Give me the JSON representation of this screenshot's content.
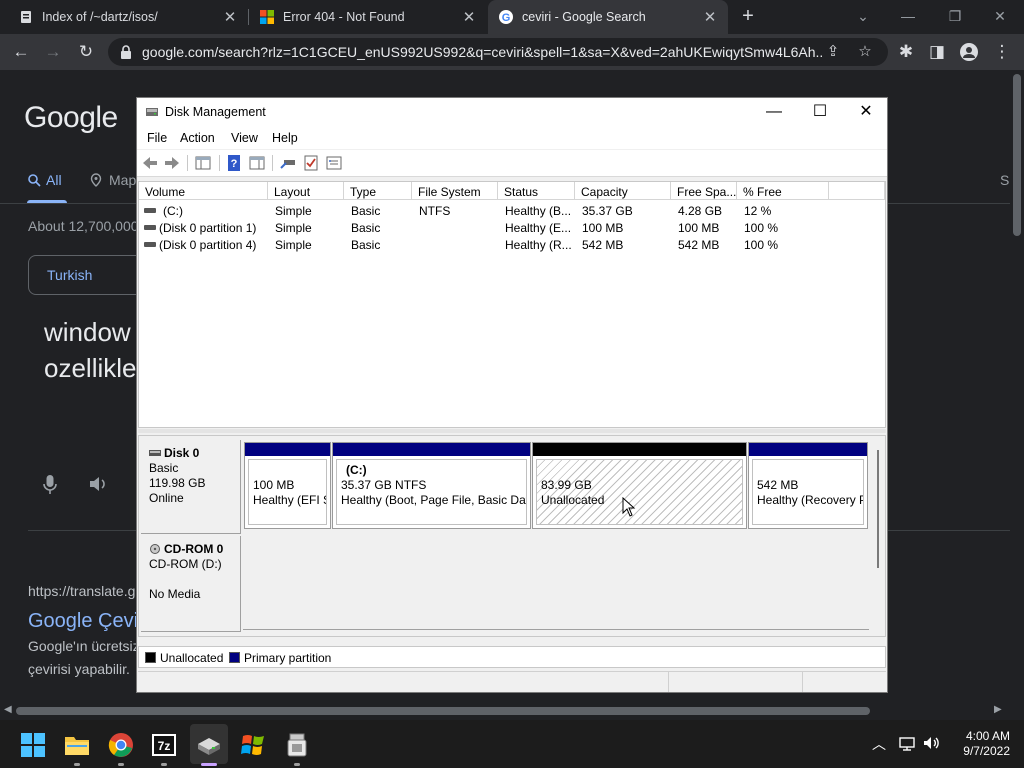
{
  "browser": {
    "tabs": [
      {
        "title": "Index of /~dartz/isos/",
        "icon": "file-server-icon"
      },
      {
        "title": "Error 404 - Not Found",
        "icon": "windows-logo-icon"
      },
      {
        "title": "ceviri - Google Search",
        "icon": "google-icon",
        "active": true
      }
    ],
    "url": "google.com/search?rlz=1C1GCEU_enUS992US992&q=ceviri&spell=1&sa=X&ved=2ahUKEwiqytSmw4L6Ah..."
  },
  "google": {
    "logo": "Google",
    "nav_all": "All",
    "nav_maps": "Map",
    "nav_right": "S",
    "stats": "About 12,700,000",
    "chip": "Turkish",
    "query_line1": "window",
    "query_line2": "ozellikle",
    "result_url": "https://translate.g",
    "result_title": "Google Çevi",
    "result_desc1": "Google'ın ücretsiz",
    "result_desc2": "çevirisi yapabilir."
  },
  "disk_management": {
    "title": "Disk Management",
    "menu": [
      "File",
      "Action",
      "View",
      "Help"
    ],
    "columns": [
      "Volume",
      "Layout",
      "Type",
      "File System",
      "Status",
      "Capacity",
      "Free Spa...",
      "% Free"
    ],
    "volumes": [
      {
        "volume": "(C:)",
        "layout": "Simple",
        "type": "Basic",
        "fs": "NTFS",
        "status": "Healthy (B...",
        "capacity": "35.37 GB",
        "free": "4.28 GB",
        "pct": "12 %"
      },
      {
        "volume": "(Disk 0 partition 1)",
        "layout": "Simple",
        "type": "Basic",
        "fs": "",
        "status": "Healthy (E...",
        "capacity": "100 MB",
        "free": "100 MB",
        "pct": "100 %"
      },
      {
        "volume": "(Disk 0 partition 4)",
        "layout": "Simple",
        "type": "Basic",
        "fs": "",
        "status": "Healthy (R...",
        "capacity": "542 MB",
        "free": "542 MB",
        "pct": "100 %"
      }
    ],
    "disk0": {
      "name": "Disk 0",
      "type": "Basic",
      "size": "119.98 GB",
      "state": "Online",
      "partitions": [
        {
          "label": "",
          "size": "100 MB",
          "status": "Healthy (EFI S"
        },
        {
          "label": "(C:)",
          "size": "35.37 GB NTFS",
          "status": "Healthy (Boot, Page File, Basic Data"
        },
        {
          "label": "",
          "size": "83.99 GB",
          "status": "Unallocated"
        },
        {
          "label": "",
          "size": "542 MB",
          "status": "Healthy (Recovery P"
        }
      ]
    },
    "cdrom": {
      "name": "CD-ROM 0",
      "drive": "CD-ROM (D:)",
      "media": "No Media"
    },
    "legend": {
      "unallocated": "Unallocated",
      "primary": "Primary partition"
    },
    "colors": {
      "unallocated": "#000000",
      "primary": "#000080"
    }
  },
  "taskbar": {
    "apps": [
      "windows-start-icon",
      "file-explorer-icon",
      "chrome-icon",
      "7zip-icon",
      "disk-management-icon",
      "windows-xp-logo-icon",
      "usb-tool-icon"
    ],
    "time": "4:00 AM",
    "date": "9/7/2022"
  }
}
